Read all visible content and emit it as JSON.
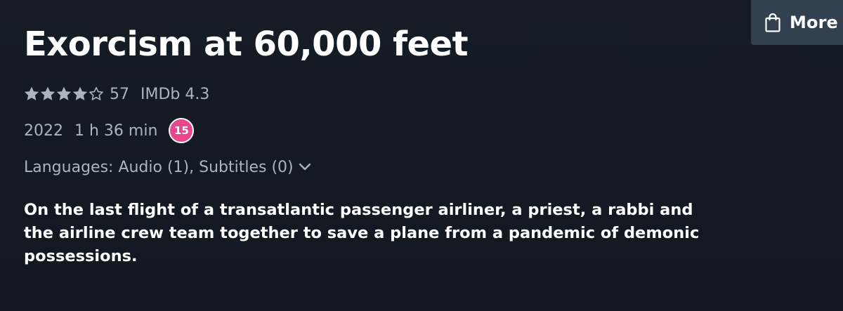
{
  "header": {
    "more_label": "More",
    "more_icon": "shopping-bag-icon"
  },
  "title": "Exorcism at 60,000 feet",
  "rating": {
    "stars": 4,
    "max_stars": 5,
    "count": "57",
    "imdb": "IMDb 4.3"
  },
  "meta": {
    "year": "2022",
    "runtime": "1 h 36 min",
    "age_rating": "15",
    "age_rating_color": "#e8478b"
  },
  "languages": {
    "label": "Languages: Audio (1), Subtitles (0)",
    "icon": "chevron-down-icon"
  },
  "synopsis": "On the last flight of a transatlantic passenger airliner, a priest, a rabbi and the airline crew team together to save a plane from a pandemic of demonic possessions.",
  "colors": {
    "background": "#121821",
    "muted_text": "#aab5c1",
    "button_bg": "#33404f"
  }
}
